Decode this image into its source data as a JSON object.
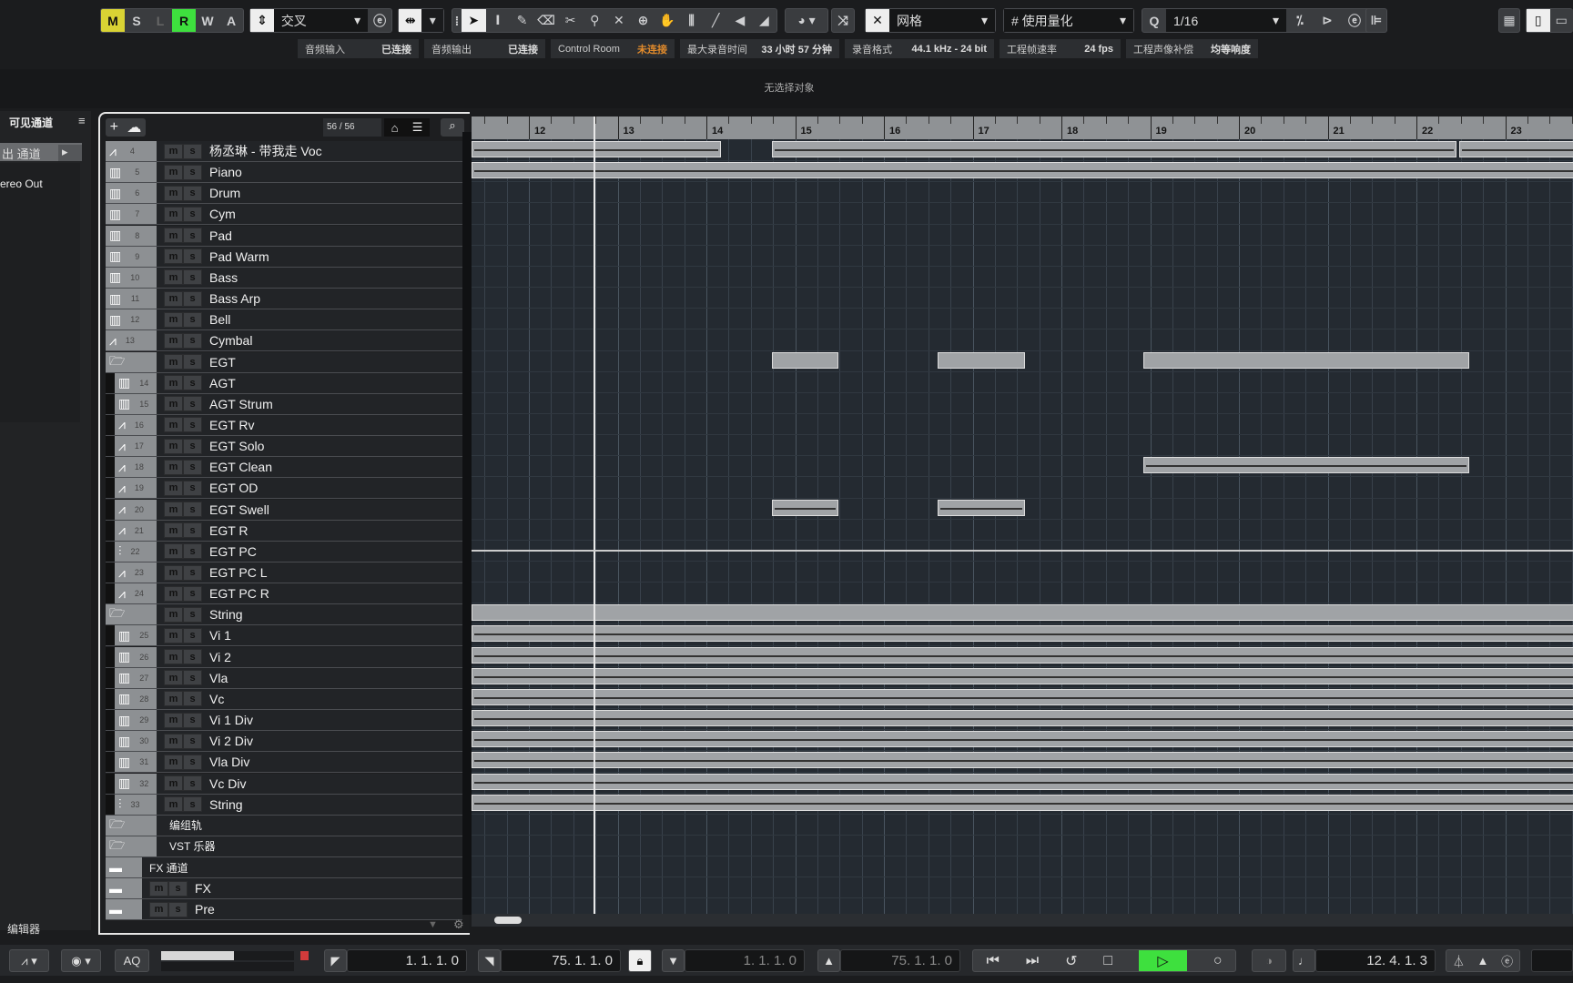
{
  "toolbar": {
    "mode_buttons": [
      {
        "label": "M",
        "color": "#d9d334"
      },
      {
        "label": "S",
        "color": ""
      },
      {
        "label": "L",
        "color": ""
      },
      {
        "label": "R",
        "color": "#3ee03e"
      },
      {
        "label": "W",
        "color": ""
      },
      {
        "label": "A",
        "color": ""
      }
    ],
    "edit_mode": "交叉",
    "tools": [
      "select-icon",
      "range-icon",
      "pencil-icon",
      "eraser-icon",
      "scissors-icon",
      "glue-icon",
      "mute-x-icon",
      "zoom-icon",
      "hand-icon",
      "comp-icon",
      "line-icon",
      "speaker-icon",
      "color-icon"
    ],
    "snap_type": "网格",
    "quantize_mode": "使用量化",
    "quantize_label": "Q",
    "quantize_value": "1/16"
  },
  "status": [
    {
      "label": "音频输入",
      "value": "已连接"
    },
    {
      "label": "音频输出",
      "value": "已连接"
    },
    {
      "label": "Control Room",
      "value": "未连接",
      "color": "#e08a2c"
    },
    {
      "label": "最大录音时间",
      "value": "33 小时 57 分钟"
    },
    {
      "label": "录音格式",
      "value": "44.1 kHz - 24 bit"
    },
    {
      "label": "工程帧速率",
      "value": "24 fps"
    },
    {
      "label": "工程声像补偿",
      "value": "均等响度"
    }
  ],
  "info_line": "无选择对象",
  "left_panel": {
    "title": "可见通道",
    "tab": "出 通道",
    "item": "ereo Out",
    "footer": "编辑器"
  },
  "track_list": {
    "count": "56 / 56",
    "tracks": [
      {
        "n": "4",
        "name": "杨丞琳 - 带我走 Voc",
        "type": "audio"
      },
      {
        "n": "5",
        "name": "Piano",
        "type": "inst"
      },
      {
        "n": "6",
        "name": "Drum",
        "type": "inst"
      },
      {
        "n": "7",
        "name": "Cym",
        "type": "inst"
      },
      {
        "n": "8",
        "name": "Pad",
        "type": "inst"
      },
      {
        "n": "9",
        "name": "Pad Warm",
        "type": "inst"
      },
      {
        "n": "10",
        "name": "Bass",
        "type": "inst"
      },
      {
        "n": "11",
        "name": "Bass Arp",
        "type": "inst"
      },
      {
        "n": "12",
        "name": "Bell",
        "type": "inst"
      },
      {
        "n": "13",
        "name": "Cymbal",
        "type": "audio"
      },
      {
        "n": "",
        "name": "EGT",
        "type": "folder-open"
      },
      {
        "n": "14",
        "name": "AGT",
        "type": "inst",
        "sub": true
      },
      {
        "n": "15",
        "name": "AGT Strum",
        "type": "inst",
        "sub": true
      },
      {
        "n": "16",
        "name": "EGT Rv",
        "type": "audio",
        "sub": true
      },
      {
        "n": "17",
        "name": "EGT  Solo",
        "type": "audio",
        "sub": true
      },
      {
        "n": "18",
        "name": "EGT  Clean",
        "type": "audio",
        "sub": true
      },
      {
        "n": "19",
        "name": "EGT  OD",
        "type": "audio",
        "sub": true
      },
      {
        "n": "20",
        "name": "EGT Swell",
        "type": "audio",
        "sub": true
      },
      {
        "n": "21",
        "name": "EGT R",
        "type": "audio",
        "sub": true
      },
      {
        "n": "22",
        "name": "EGT PC",
        "type": "group",
        "sub": true
      },
      {
        "n": "23",
        "name": "EGT PC L",
        "type": "audio",
        "sub": true
      },
      {
        "n": "24",
        "name": "EGT PC R",
        "type": "audio",
        "sub": true
      },
      {
        "n": "",
        "name": "String",
        "type": "folder-open"
      },
      {
        "n": "25",
        "name": "Vi 1",
        "type": "inst",
        "sub": true
      },
      {
        "n": "26",
        "name": "Vi 2",
        "type": "inst",
        "sub": true
      },
      {
        "n": "27",
        "name": "Vla",
        "type": "inst",
        "sub": true
      },
      {
        "n": "28",
        "name": "Vc",
        "type": "inst",
        "sub": true
      },
      {
        "n": "29",
        "name": "Vi 1 Div",
        "type": "inst",
        "sub": true
      },
      {
        "n": "30",
        "name": "Vi 2 Div",
        "type": "inst",
        "sub": true
      },
      {
        "n": "31",
        "name": "Vla Div",
        "type": "inst",
        "sub": true
      },
      {
        "n": "32",
        "name": "Vc Div",
        "type": "inst",
        "sub": true
      },
      {
        "n": "33",
        "name": "String",
        "type": "group",
        "sub": true
      },
      {
        "n": "",
        "name": "编组轨",
        "type": "folder-nm"
      },
      {
        "n": "",
        "name": "VST 乐器",
        "type": "folder-nm"
      },
      {
        "n": "",
        "name": "FX 通道",
        "type": "folder-closed-nm"
      },
      {
        "n": "",
        "name": "FX",
        "type": "folder-closed"
      },
      {
        "n": "",
        "name": "Pre",
        "type": "folder-closed"
      }
    ]
  },
  "ruler": {
    "bars": [
      "12",
      "13",
      "14",
      "15",
      "16",
      "17",
      "18",
      "19",
      "20",
      "21",
      "22",
      "23"
    ]
  },
  "transport": {
    "aq": "AQ",
    "left_locator": "1. 1. 1.   0",
    "right_locator": "75. 1. 1.   0",
    "punch_in": "1. 1. 1.   0",
    "punch_out": "75. 1. 1.   0",
    "position": "12. 4. 1.   3",
    "play_active_color": "#3ee03e"
  }
}
